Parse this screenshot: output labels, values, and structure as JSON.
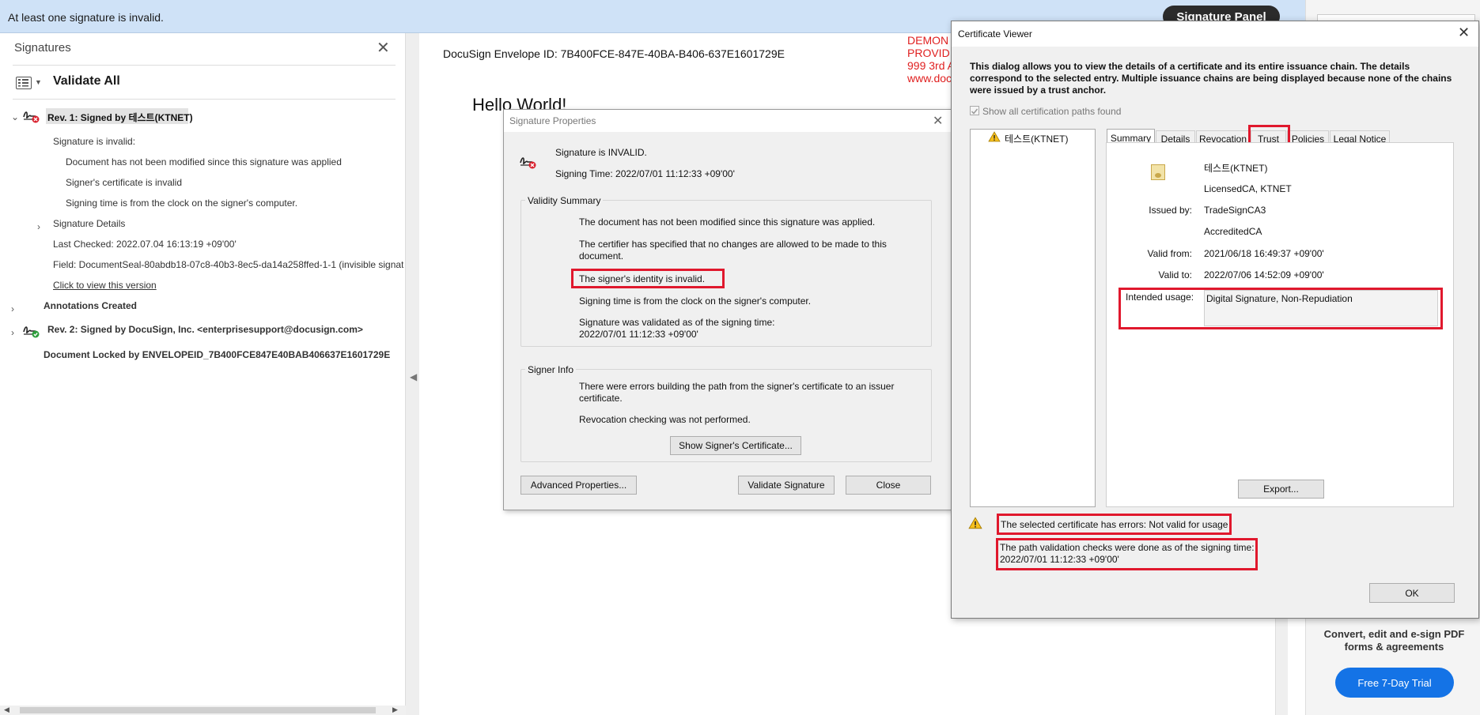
{
  "banner": {
    "message": "At least one signature is invalid.",
    "signature_panel_button": "Signature Panel"
  },
  "signatures_panel": {
    "title": "Signatures",
    "close_glyph": "✕",
    "validate_all": "Validate All",
    "rev1": {
      "label": "Rev. 1: Signed by 테스트(KTNET)",
      "status": "Signature is invalid:",
      "details": [
        "Document has not been modified since this signature was applied",
        "Signer's certificate is invalid",
        "Signing time is from the clock on the signer's computer."
      ],
      "signature_details": "Signature Details",
      "last_checked": "Last Checked: 2022.07.04 16:13:19 +09'00'",
      "field": "Field: DocumentSeal-80abdb18-07c8-40b3-8ec5-da14a258ffed-1-1 (invisible signatu",
      "view_version_link": "Click to view this version"
    },
    "annotations_created": "Annotations Created",
    "rev2": {
      "label": "Rev. 2: Signed by DocuSign, Inc. <enterprisesupport@docusign.com>"
    },
    "document_locked": "Document Locked by ENVELOPEID_7B400FCE847E40BAB406637E1601729E"
  },
  "document": {
    "envelope_id": "DocuSign Envelope ID: 7B400FCE-847E-40BA-B406-637E1601729E",
    "hello": "Hello World!",
    "red_lines": [
      "DEMON",
      "PROVID",
      "999 3rd A",
      "www.doc"
    ]
  },
  "signature_properties": {
    "title": "Signature Properties",
    "status": "Signature is INVALID.",
    "signing_time": "Signing Time:  2022/07/01 11:12:33 +09'00'",
    "validity_summary_label": "Validity Summary",
    "validity_lines": [
      "The document has not been modified since this signature was applied.",
      "The certifier has specified that no changes are allowed to be made to this",
      "document.",
      "The signer's identity is invalid.",
      "Signing time is from the clock on the signer's computer.",
      "Signature was validated as of the signing time:",
      "2022/07/01 11:12:33 +09'00'"
    ],
    "signer_info_label": "Signer Info",
    "signer_lines": [
      "There were errors building the path from the signer's certificate to an issuer",
      "certificate.",
      "Revocation checking was not performed."
    ],
    "show_cert_button": "Show Signer's Certificate...",
    "advanced_button": "Advanced Properties...",
    "validate_button": "Validate Signature",
    "close_button": "Close"
  },
  "certificate_viewer": {
    "title": "Certificate Viewer",
    "description": "This dialog allows you to view the details of a certificate and its entire issuance chain. The details correspond to the selected entry. Multiple issuance chains are being displayed because none of the chains were issued by a trust anchor.",
    "show_all_paths": "Show all certification paths found",
    "tree_item": "테스트(KTNET)",
    "tabs": [
      "Summary",
      "Details",
      "Revocation",
      "Trust",
      "Policies",
      "Legal Notice"
    ],
    "summary": {
      "subject_name": "테스트(KTNET)",
      "subject_org": "LicensedCA, KTNET",
      "issued_by_label": "Issued by:",
      "issued_by_name": "TradeSignCA3",
      "issued_by_org": "AccreditedCA",
      "valid_from_label": "Valid from:",
      "valid_from": "2021/06/18 16:49:37 +09'00'",
      "valid_to_label": "Valid to:",
      "valid_to": "2022/07/06 14:52:09 +09'00'",
      "intended_usage_label": "Intended usage:",
      "intended_usage": "Digital Signature, Non-Repudiation"
    },
    "export_button": "Export...",
    "error_message": "The selected certificate has errors: Not valid for usage",
    "path_validation_line1": "The path validation checks were done as of the signing time:",
    "path_validation_line2": "2022/07/01 11:12:33 +09'00'",
    "ok_button": "OK"
  },
  "promo": {
    "text": "Convert, edit and e-sign PDF forms & agreements",
    "trial_button": "Free 7-Day Trial"
  },
  "colors": {
    "banner_bg": "#cfe2f7",
    "highlight_red": "#e0182d",
    "trial_blue": "#1473e6",
    "invalid_red": "#d9212e",
    "valid_green": "#2e9e3c"
  },
  "icons": [
    "signature-invalid-icon",
    "signature-valid-icon",
    "warning-icon",
    "certificate-icon",
    "close-icon",
    "chevron-right-icon",
    "chevron-down-icon",
    "list-icon"
  ]
}
